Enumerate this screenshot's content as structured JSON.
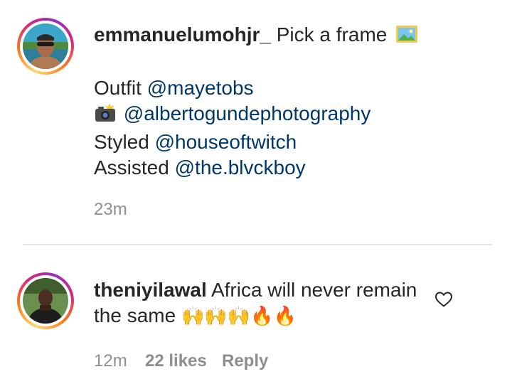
{
  "post_caption": {
    "username": "emmanuelumohjr_",
    "first_line_text": "Pick a frame",
    "first_line_icon": "framed-picture-icon",
    "credits": [
      {
        "prefix": "Outfit",
        "mention": "@mayetobs"
      },
      {
        "prefix_icon": "camera-flash-icon",
        "mention": "@albertogundephotography"
      },
      {
        "prefix": "Styled",
        "mention": "@houseoftwitch"
      },
      {
        "prefix": "Assisted",
        "mention": "@the.blvckboy"
      }
    ],
    "timestamp": "23m"
  },
  "comment": {
    "username": "theniyilawal",
    "text": "Africa will never remain the same",
    "emojis": "🙌🙌🙌🔥🔥",
    "timestamp": "12m",
    "likes": "22 likes",
    "reply_label": "Reply",
    "like_icon": "heart-outline-icon"
  },
  "colors": {
    "mention": "#00376b",
    "meta_text": "#8e8e8e",
    "primary_text": "#262626"
  }
}
